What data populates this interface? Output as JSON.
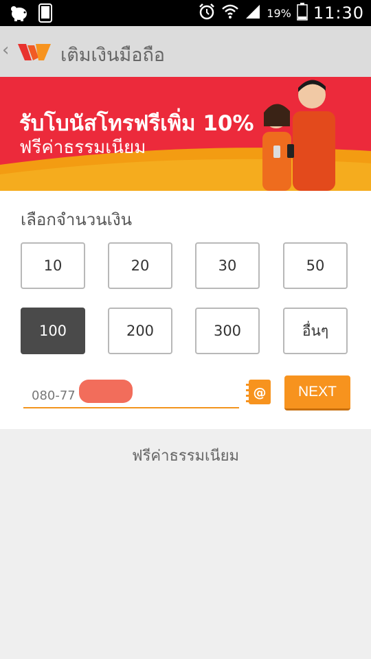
{
  "status_bar": {
    "battery_pct": "19%",
    "clock": "11:30",
    "icons": [
      "piggy-bank-icon",
      "phone-icon",
      "alarm-icon",
      "wifi-icon",
      "signal-icon",
      "battery-icon"
    ]
  },
  "app_bar": {
    "back_icon": "chevron-left-icon",
    "title": "เติมเงินมือถือ"
  },
  "banner": {
    "line1": "รับโบนัสโทรฟรีเพิ่ม 10%",
    "line2": "ฟรีค่าธรรมเนียม"
  },
  "amount_section": {
    "label": "เลือกจำนวนเงิน",
    "options": [
      "10",
      "20",
      "30",
      "50",
      "100",
      "200",
      "300",
      "อื่นๆ"
    ],
    "selected": "100"
  },
  "phone": {
    "value": "080-77"
  },
  "next_button": "NEXT",
  "footer_note": "ฟรีค่าธรรมเนียม",
  "colors": {
    "accent": "#f7931e",
    "banner_red": "#ee2d3a",
    "selected": "#4a4a4a"
  }
}
